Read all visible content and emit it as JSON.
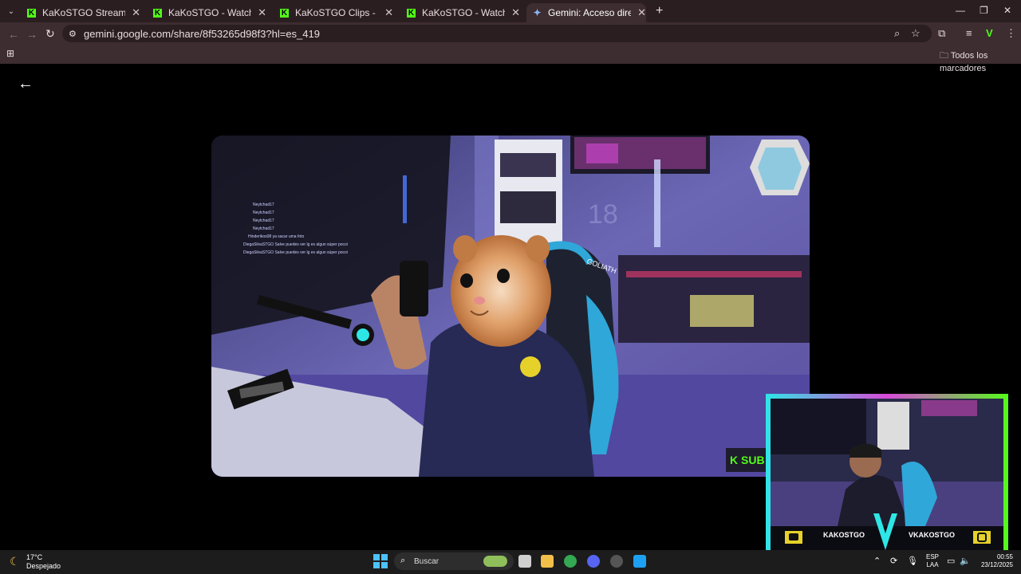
{
  "tabs": [
    {
      "title": "KaKoSTGO Stream - Watch Live",
      "icon": "kick-icon"
    },
    {
      "title": "KaKoSTGO - Watch the VOD on",
      "icon": "kick-icon"
    },
    {
      "title": "KaKoSTGO Clips - Watch Live o",
      "icon": "kick-icon"
    },
    {
      "title": "KaKoSTGO - Watch the VOD on",
      "icon": "kick-icon"
    },
    {
      "title": "Gemini: Acceso directo a la IA d",
      "icon": "gemini-icon",
      "active": true
    }
  ],
  "tab_close_glyph": "✕",
  "new_tab_glyph": "+",
  "address_bar": {
    "url": "gemini.google.com/share/8f53265d98f3?hl=es_419"
  },
  "bookmarks": {
    "all_bookmarks_label": "Todos los marcadores"
  },
  "overlay": {
    "brand_left": "KAKOSTGO",
    "brand_right": "VKAKOSTGO"
  },
  "video_chat": [
    "Neytchad17",
    "Neytchad17",
    "Neytchad17",
    "Neytchad17",
    "Hinderikos08 ya sacar uma foto",
    "DiegaSilvaSTGO Salve puedes ver lg es algun súper pocoi",
    "DiegaSilvaSTGO Salve puedes ver lg es algun súper pocoi"
  ],
  "taskbar": {
    "weather_temp": "17°C",
    "weather_desc": "Despejado",
    "search_label": "Buscar",
    "lang_top": "ESP",
    "lang_bottom": "LAA",
    "time": "00:55",
    "date": "23/12/2025"
  },
  "colors": {
    "tab_strip": "#2b1e21",
    "toolbar": "#3d2d30",
    "kick_green": "#53fc18"
  }
}
